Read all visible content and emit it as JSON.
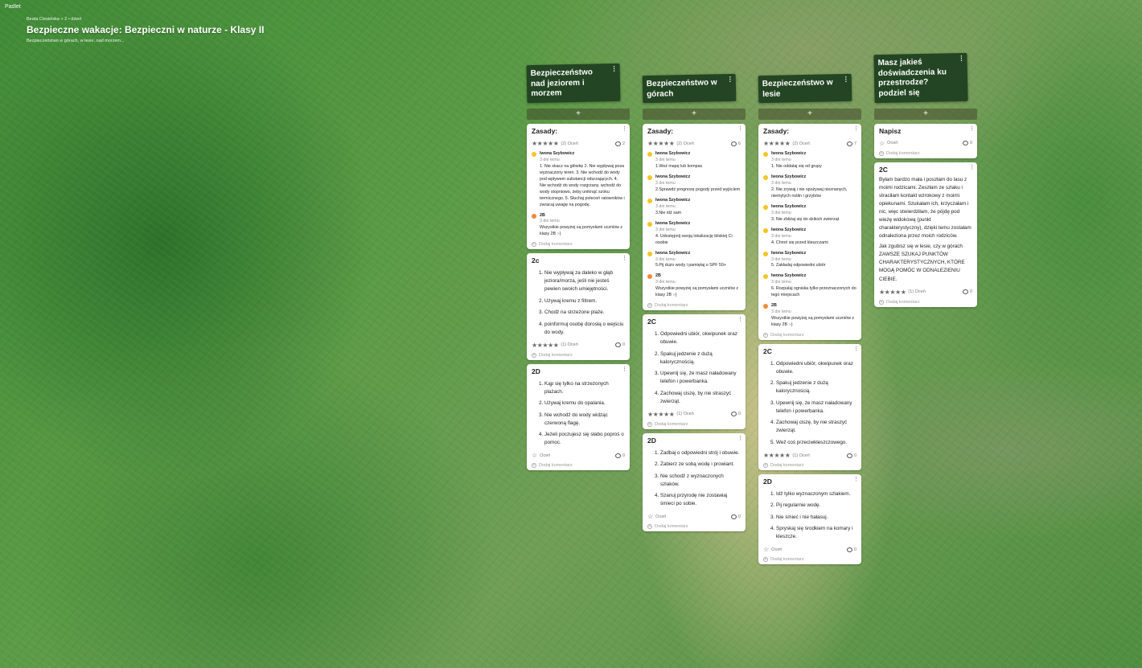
{
  "brand": "Padlet",
  "header": {
    "author": "Beata Ciesielska + 2 • dzień",
    "title": "Bezpieczne wakacje: Bezpieczni w naturze - Klasy II",
    "subtitle": "Bezpieczeństwo w górach, w lesie, nad morzem..."
  },
  "ui": {
    "add": "+",
    "add_comment": "Dodaj komentarz",
    "rate": "Oceń",
    "menu": "⋮"
  },
  "columns": [
    {
      "title": "Bezpieczeństwo nad jeziorem i morzem",
      "cards": [
        {
          "title": "Zasady:",
          "stars": 5,
          "rating_label": "(2) Oceń",
          "comment_count": "2",
          "comments": [
            {
              "author": "Iwona Szybowicz",
              "time": "3 dni temu",
              "text": "1. Nie skacz na główkę 2. Nie wypływaj poza wyznaczony teren. 3. Nie wchodź do wody pod wpływem substancji odurzających. 4. Nie wchodź do wody rozgrzany, wchodź do wody stopniowo, żeby uniknąć szoku termicznego. 5. Słuchaj poleceń ratowników i zwracaj uwagę na pogodę."
            },
            {
              "author": "2B",
              "time": "3 dni temu",
              "text": "Wszystkie powyżej są pomysłami uczniów z klasy 2B :-)",
              "avatar": "orange"
            }
          ]
        },
        {
          "title": "2c",
          "items": [
            "Nie wypływaj za daleko w głąb jeziora/morza, jeśli nie jesteś pewien swoich umiejętności.",
            "Używaj kremu z filtrem.",
            "Chodź na strzeżone plaże.",
            "poinformuj osobę dorosłą o wejściu do wody."
          ],
          "stars": 5,
          "rating_label": "(1) Oceń",
          "comment_count": "0"
        },
        {
          "title": "2D",
          "items": [
            "Kąp się tylko na strzeżonych plażach.",
            "Używaj kremu do opalania.",
            "Nie wchodź do wody widząc czerwoną flagę.",
            "Jeżeli poczujesz się słabo poproś o pomoc."
          ],
          "stars": 0,
          "rating_label": "Oceń",
          "comment_count": "0"
        }
      ]
    },
    {
      "title": "Bezpieczeństwo w górach",
      "cards": [
        {
          "title": "Zasady:",
          "stars": 5,
          "rating_label": "(2) Oceń",
          "comment_count": "6",
          "comments": [
            {
              "author": "Iwona Szybowicz",
              "time": "3 dni temu",
              "text": "1.Weź mapę lub kompas"
            },
            {
              "author": "Iwona Szybowicz",
              "time": "3 dni temu",
              "text": "2.Sprawdź prognozę pogody przed wyjściem"
            },
            {
              "author": "Iwona Szybowicz",
              "time": "3 dni temu",
              "text": "3.Nie idź sam"
            },
            {
              "author": "Iwona Szybowicz",
              "time": "3 dni temu",
              "text": "4. Udostępnij swoją lokalizację bliskiej Ci osobie"
            },
            {
              "author": "Iwona Szybowicz",
              "time": "3 dni temu",
              "text": "5.Pij dużo wody i pamiętaj o SPF 50+"
            },
            {
              "author": "2B",
              "time": "3 dni temu",
              "text": "Wszystkie powyżej są pomysłami uczniów z klasy 2B :-)",
              "avatar": "orange"
            }
          ]
        },
        {
          "title": "2C",
          "items": [
            "Odpowiedni ubiór, okwipunek oraz obuwie.",
            "Spakuj jedzenie z dużą kalorycznością.",
            "Upewnij się, że masz naładowany telefon i powerbanka.",
            "Zachowaj ciszę, by nie straszyć zwierząt."
          ],
          "stars": 5,
          "rating_label": "(1) Oceń",
          "comment_count": "0"
        },
        {
          "title": "2D",
          "items": [
            "Zadbaj o odpowiedni strój i obuwie.",
            "Zabierz ze sobą wodę i prowiant.",
            "Nie schodź z wyznaczonych szlaków.",
            "Szanuj przyrodę nie zostawiaj śmieci po sobie."
          ],
          "stars": 0,
          "rating_label": "Oceń",
          "comment_count": "0"
        }
      ]
    },
    {
      "title": "Bezpieczeństwo w lesie",
      "cards": [
        {
          "title": "Zasady:",
          "stars": 5,
          "rating_label": "(2) Oceń",
          "comment_count": "7",
          "comments": [
            {
              "author": "Iwona Szybowicz",
              "time": "3 dni temu",
              "text": "1. Nie oddalaj się od grupy"
            },
            {
              "author": "Iwona Szybowicz",
              "time": "3 dni temu",
              "text": "2. Nie zrywaj i nie spożywaj nieznanych, niemytych roślin i grzybów"
            },
            {
              "author": "Iwona Szybowicz",
              "time": "3 dni temu",
              "text": "3. Nie zbliżaj się do dzikich zwierząt"
            },
            {
              "author": "Iwona Szybowicz",
              "time": "3 dni temu",
              "text": "4. Chroń się przed kleszczami"
            },
            {
              "author": "Iwona Szybowicz",
              "time": "3 dni temu",
              "text": "5. Zakładaj odpowiedni ubiór"
            },
            {
              "author": "Iwona Szybowicz",
              "time": "3 dni temu",
              "text": "6. Rozpalaj ogniska tylko przeznaczonych do tego miejscach"
            },
            {
              "author": "2B",
              "time": "3 dni temu",
              "text": "Wszystkie powyżej są pomysłami uczniów z klasy 2B :-)",
              "avatar": "orange"
            }
          ]
        },
        {
          "title": "2C",
          "items": [
            "Odpowiedni ubiór, okwipunek oraz obuwie.",
            "Spakuj jedzenie z dużą kalorycznością.",
            "Upewnij się, że masz naładowany telefon i powerbanka.",
            "Zachowaj ciszę, by nie straszyć zwierząt.",
            "Weź coś przeciwkleszczowego."
          ],
          "stars": 5,
          "rating_label": "(1) Oceń",
          "comment_count": "0"
        },
        {
          "title": "2D",
          "items": [
            "Idź tylko wyznaczonym szlakiem.",
            "Pij regularnie wodę.",
            "Nie śmieć i nie hałasuj.",
            "Spryskaj się środkiem na komary i kleszcze."
          ],
          "stars": 0,
          "rating_label": "Oceń",
          "comment_count": "0"
        }
      ]
    },
    {
      "title": "Masz jakieś doświadczenia ku przestrodze? podziel się",
      "cards": [
        {
          "title": "Napisz",
          "stars": 0,
          "rating_label": "Oceń",
          "comment_count": "0"
        },
        {
          "title": "2C",
          "paragraphs": [
            "Byłam bardzo mała i poszłam do lasu z moimi rodzicami. Zeszłam ze szlaku i straciłam kontakt wzrokowy z moimi opiekunami. Szukałam ich, krzyczałam i nic, więc stwierdziłam, że pójdę pod wieżę widokową (punkt charakterystyczny), dzięki temu zostałam odnaleziona przez moich rodziców.",
            "Jak zgubisz się w lesie, czy w górach ZAWSZE SZUKAJ PUNKTÓW CHARAKTERYSTYCZNYCH, KTÓRE MOGĄ POMÓC W ODNALEZIENIU CIEBIE."
          ],
          "stars": 5,
          "rating_label": "(1) Oceń",
          "comment_count": "0"
        }
      ]
    }
  ]
}
